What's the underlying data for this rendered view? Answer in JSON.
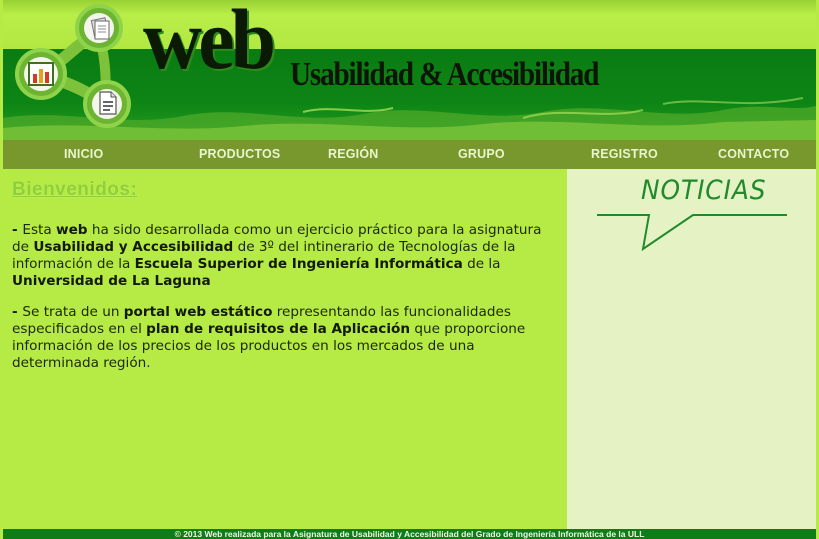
{
  "site": {
    "logo_word": "web",
    "logo_subtitle": "Usabilidad & Accesibilidad"
  },
  "nav": {
    "items": [
      {
        "label": "INICIO"
      },
      {
        "label": "PRODUCTOS"
      },
      {
        "label": "REGIÓN"
      },
      {
        "label": "GRUPO"
      },
      {
        "label": "REGISTRO"
      },
      {
        "label": "CONTACTO"
      }
    ]
  },
  "main": {
    "heading": "Bienvenidos:",
    "p1": {
      "dash": "- ",
      "t1": "Esta ",
      "b1": "web",
      "t2": " ha sido desarrollada como un ejercicio práctico para la asignatura de ",
      "b2": "Usabilidad y Accesibilidad",
      "t3": " de 3º del intinerario de Tecnologías de la información de la ",
      "b3": "Escuela Superior de Ingeniería Informática",
      "t4": " de la ",
      "b4": "Universidad de La Laguna"
    },
    "p2": {
      "dash": "- ",
      "t1": "Se trata de un ",
      "b1": "portal web estático",
      "t2": " representando las funcionalidades especificados en el ",
      "b2": "plan de requisitos de la Aplicación",
      "t3": " que proporcione información de los precios de los productos en los mercados de una determinada región."
    }
  },
  "sidebar": {
    "title": "NOTICIAS"
  },
  "footer": {
    "text": "© 2013 Web realizada para la Asignatura de Usabilidad y Accesibilidad del Grado de Ingeniería Informática de la ULL"
  },
  "colors": {
    "page_bg": "#b6eb45",
    "header_green": "#0a7c12",
    "nav_bg": "#78972c",
    "sidebar_bg": "#e5f2c4",
    "noticias_green": "#208a2c",
    "footer_bg": "#0e7d17"
  },
  "icons": [
    "document-icon",
    "bar-chart-icon",
    "file-list-icon"
  ]
}
